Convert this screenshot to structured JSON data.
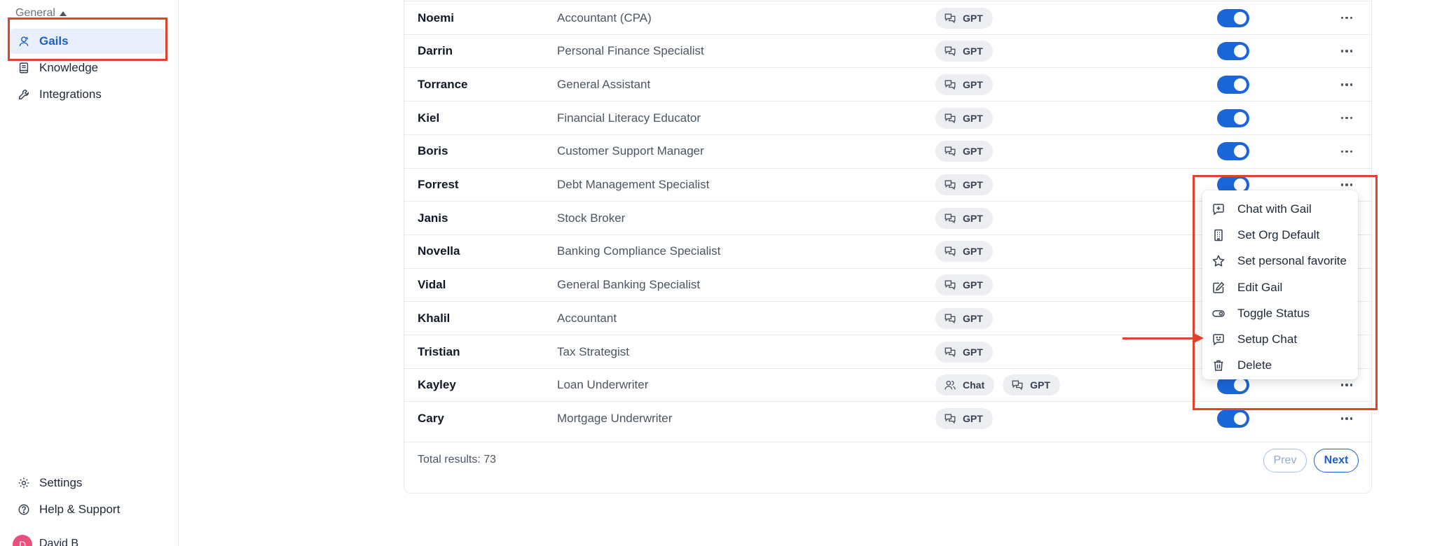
{
  "sidebar": {
    "section_label": "General",
    "items": [
      {
        "label": "Gails",
        "icon": "person-icon",
        "active": true
      },
      {
        "label": "Knowledge",
        "icon": "book-icon",
        "active": false
      },
      {
        "label": "Integrations",
        "icon": "wrench-icon",
        "active": false
      }
    ],
    "bottom": [
      {
        "label": "Settings",
        "icon": "gear-icon"
      },
      {
        "label": "Help & Support",
        "icon": "help-icon"
      }
    ],
    "user": {
      "initial": "D",
      "name": "David B"
    }
  },
  "table": {
    "rows": [
      {
        "name": "Noemi",
        "role": "Accountant (CPA)",
        "types": [
          "GPT"
        ],
        "enabled": true
      },
      {
        "name": "Darrin",
        "role": "Personal Finance Specialist",
        "types": [
          "GPT"
        ],
        "enabled": true
      },
      {
        "name": "Torrance",
        "role": "General Assistant",
        "types": [
          "GPT"
        ],
        "enabled": true
      },
      {
        "name": "Kiel",
        "role": "Financial Literacy Educator",
        "types": [
          "GPT"
        ],
        "enabled": true
      },
      {
        "name": "Boris",
        "role": "Customer Support Manager",
        "types": [
          "GPT"
        ],
        "enabled": true
      },
      {
        "name": "Forrest",
        "role": "Debt Management Specialist",
        "types": [
          "GPT"
        ],
        "enabled": true
      },
      {
        "name": "Janis",
        "role": "Stock Broker",
        "types": [
          "GPT"
        ],
        "enabled": true
      },
      {
        "name": "Novella",
        "role": "Banking Compliance Specialist",
        "types": [
          "GPT"
        ],
        "enabled": true
      },
      {
        "name": "Vidal",
        "role": "General Banking Specialist",
        "types": [
          "GPT"
        ],
        "enabled": true
      },
      {
        "name": "Khalil",
        "role": "Accountant",
        "types": [
          "GPT"
        ],
        "enabled": true
      },
      {
        "name": "Tristian",
        "role": "Tax Strategist",
        "types": [
          "GPT"
        ],
        "enabled": true
      },
      {
        "name": "Kayley",
        "role": "Loan Underwriter",
        "types": [
          "Chat",
          "GPT"
        ],
        "enabled": true
      },
      {
        "name": "Cary",
        "role": "Mortgage Underwriter",
        "types": [
          "GPT"
        ],
        "enabled": true
      }
    ],
    "total_label": "Total results: 73",
    "prev_label": "Prev",
    "next_label": "Next"
  },
  "context_menu": {
    "items": [
      {
        "label": "Chat with Gail",
        "icon": "chat-plus-icon"
      },
      {
        "label": "Set Org Default",
        "icon": "building-icon"
      },
      {
        "label": "Set personal favorite",
        "icon": "star-icon"
      },
      {
        "label": "Edit Gail",
        "icon": "pencil-icon"
      },
      {
        "label": "Toggle Status",
        "icon": "toggle-icon"
      },
      {
        "label": "Setup Chat",
        "icon": "chat-smile-icon"
      },
      {
        "label": "Delete",
        "icon": "trash-icon"
      }
    ]
  },
  "colors": {
    "accent": "#1a66d6",
    "annotation": "#e0432b",
    "active_nav_bg": "#e8effb"
  }
}
